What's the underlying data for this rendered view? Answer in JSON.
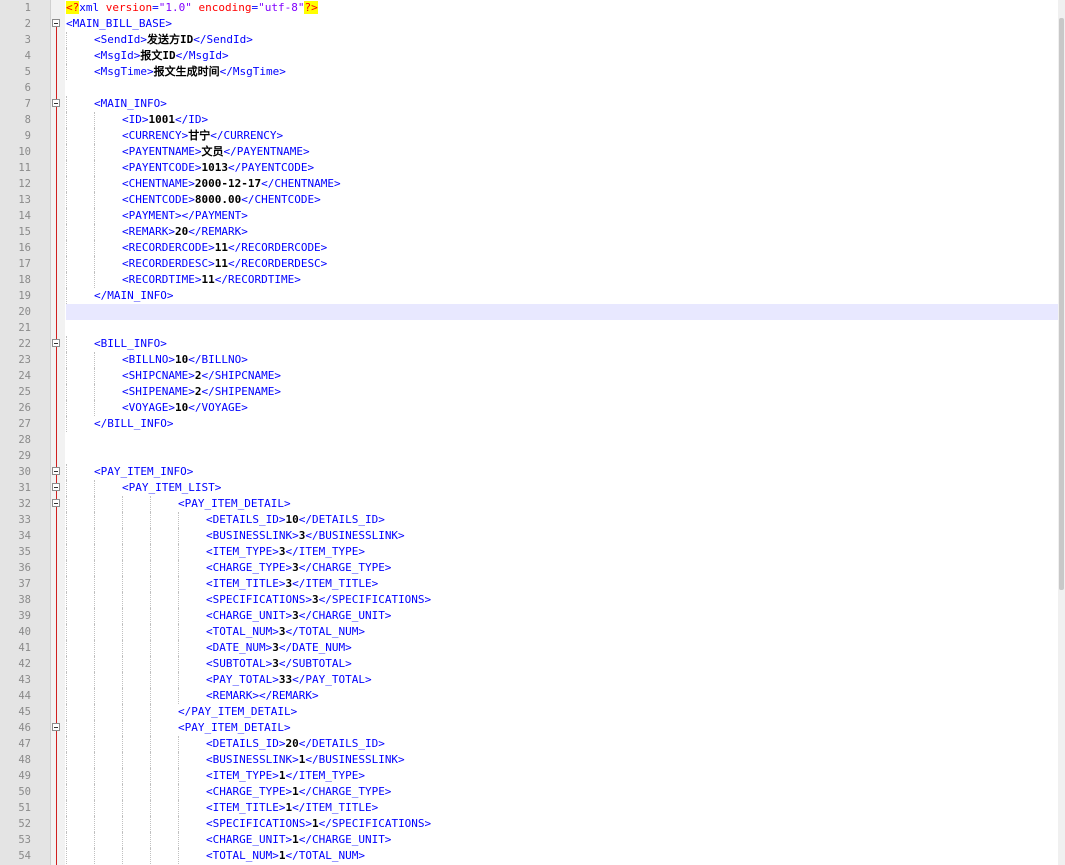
{
  "editor": {
    "lines": [
      {
        "n": "1",
        "depth": 0,
        "fold": false,
        "parts": [
          [
            "pi",
            "<?"
          ],
          [
            "tag",
            "xml "
          ],
          [
            "attr",
            "version"
          ],
          [
            "tag",
            "="
          ],
          [
            "val",
            "\"1.0\""
          ],
          [
            "tag",
            " "
          ],
          [
            "attr",
            "encoding"
          ],
          [
            "tag",
            "="
          ],
          [
            "val",
            "\"utf-8\""
          ],
          [
            "pi",
            "?>"
          ]
        ]
      },
      {
        "n": "2",
        "depth": 0,
        "fold": true,
        "parts": [
          [
            "tag",
            "<MAIN_BILL_BASE>"
          ]
        ]
      },
      {
        "n": "3",
        "depth": 1,
        "fold": false,
        "parts": [
          [
            "tag",
            "<SendId>"
          ],
          [
            "txt",
            "发送方ID"
          ],
          [
            "tag",
            "</SendId>"
          ]
        ]
      },
      {
        "n": "4",
        "depth": 1,
        "fold": false,
        "parts": [
          [
            "tag",
            "<MsgId>"
          ],
          [
            "txt",
            "报文ID"
          ],
          [
            "tag",
            "</MsgId>"
          ]
        ]
      },
      {
        "n": "5",
        "depth": 1,
        "fold": false,
        "parts": [
          [
            "tag",
            "<MsgTime>"
          ],
          [
            "txt",
            "报文生成时间"
          ],
          [
            "tag",
            "</MsgTime>"
          ]
        ]
      },
      {
        "n": "6",
        "depth": 0,
        "fold": false,
        "parts": []
      },
      {
        "n": "7",
        "depth": 1,
        "fold": true,
        "parts": [
          [
            "tag",
            "<MAIN_INFO>"
          ]
        ]
      },
      {
        "n": "8",
        "depth": 2,
        "fold": false,
        "parts": [
          [
            "tag",
            "<ID>"
          ],
          [
            "txt",
            "1001"
          ],
          [
            "tag",
            "</ID>"
          ]
        ]
      },
      {
        "n": "9",
        "depth": 2,
        "fold": false,
        "parts": [
          [
            "tag",
            "<CURRENCY>"
          ],
          [
            "txt",
            "甘宁"
          ],
          [
            "tag",
            "</CURRENCY>"
          ]
        ]
      },
      {
        "n": "10",
        "depth": 2,
        "fold": false,
        "parts": [
          [
            "tag",
            "<PAYENTNAME>"
          ],
          [
            "txt",
            "文员"
          ],
          [
            "tag",
            "</PAYENTNAME>"
          ]
        ]
      },
      {
        "n": "11",
        "depth": 2,
        "fold": false,
        "parts": [
          [
            "tag",
            "<PAYENTCODE>"
          ],
          [
            "txt",
            "1013"
          ],
          [
            "tag",
            "</PAYENTCODE>"
          ]
        ]
      },
      {
        "n": "12",
        "depth": 2,
        "fold": false,
        "parts": [
          [
            "tag",
            "<CHENTNAME>"
          ],
          [
            "txt",
            "2000-12-17"
          ],
          [
            "tag",
            "</CHENTNAME>"
          ]
        ]
      },
      {
        "n": "13",
        "depth": 2,
        "fold": false,
        "parts": [
          [
            "tag",
            "<CHENTCODE>"
          ],
          [
            "txt",
            "8000.00"
          ],
          [
            "tag",
            "</CHENTCODE>"
          ]
        ]
      },
      {
        "n": "14",
        "depth": 2,
        "fold": false,
        "parts": [
          [
            "tag",
            "<PAYMENT></PAYMENT>"
          ]
        ]
      },
      {
        "n": "15",
        "depth": 2,
        "fold": false,
        "parts": [
          [
            "tag",
            "<REMARK>"
          ],
          [
            "txt",
            "20"
          ],
          [
            "tag",
            "</REMARK>"
          ]
        ]
      },
      {
        "n": "16",
        "depth": 2,
        "fold": false,
        "parts": [
          [
            "tag",
            "<RECORDERCODE>"
          ],
          [
            "txt",
            "11"
          ],
          [
            "tag",
            "</RECORDERCODE>"
          ]
        ]
      },
      {
        "n": "17",
        "depth": 2,
        "fold": false,
        "parts": [
          [
            "tag",
            "<RECORDERDESC>"
          ],
          [
            "txt",
            "11"
          ],
          [
            "tag",
            "</RECORDERDESC>"
          ]
        ]
      },
      {
        "n": "18",
        "depth": 2,
        "fold": false,
        "parts": [
          [
            "tag",
            "<RECORDTIME>"
          ],
          [
            "txt",
            "11"
          ],
          [
            "tag",
            "</RECORDTIME>"
          ]
        ]
      },
      {
        "n": "19",
        "depth": 1,
        "fold": false,
        "parts": [
          [
            "tag",
            "</MAIN_INFO>"
          ]
        ]
      },
      {
        "n": "20",
        "depth": 0,
        "fold": false,
        "current": true,
        "parts": []
      },
      {
        "n": "21",
        "depth": 0,
        "fold": false,
        "parts": []
      },
      {
        "n": "22",
        "depth": 1,
        "fold": true,
        "parts": [
          [
            "tag",
            "<BILL_INFO>"
          ]
        ]
      },
      {
        "n": "23",
        "depth": 2,
        "fold": false,
        "parts": [
          [
            "tag",
            "<BILLNO>"
          ],
          [
            "txt",
            "10"
          ],
          [
            "tag",
            "</BILLNO>"
          ]
        ]
      },
      {
        "n": "24",
        "depth": 2,
        "fold": false,
        "parts": [
          [
            "tag",
            "<SHIPCNAME>"
          ],
          [
            "txt",
            "2"
          ],
          [
            "tag",
            "</SHIPCNAME>"
          ]
        ]
      },
      {
        "n": "25",
        "depth": 2,
        "fold": false,
        "parts": [
          [
            "tag",
            "<SHIPENAME>"
          ],
          [
            "txt",
            "2"
          ],
          [
            "tag",
            "</SHIPENAME>"
          ]
        ]
      },
      {
        "n": "26",
        "depth": 2,
        "fold": false,
        "parts": [
          [
            "tag",
            "<VOYAGE>"
          ],
          [
            "txt",
            "10"
          ],
          [
            "tag",
            "</VOYAGE>"
          ]
        ]
      },
      {
        "n": "27",
        "depth": 1,
        "fold": false,
        "parts": [
          [
            "tag",
            "</BILL_INFO>"
          ]
        ]
      },
      {
        "n": "28",
        "depth": 0,
        "fold": false,
        "parts": []
      },
      {
        "n": "29",
        "depth": 0,
        "fold": false,
        "parts": []
      },
      {
        "n": "30",
        "depth": 1,
        "fold": true,
        "parts": [
          [
            "tag",
            "<PAY_ITEM_INFO>"
          ]
        ]
      },
      {
        "n": "31",
        "depth": 2,
        "fold": true,
        "parts": [
          [
            "tag",
            "<PAY_ITEM_LIST>"
          ]
        ]
      },
      {
        "n": "32",
        "depth": 4,
        "fold": true,
        "parts": [
          [
            "tag",
            "<PAY_ITEM_DETAIL>"
          ]
        ]
      },
      {
        "n": "33",
        "depth": 5,
        "fold": false,
        "parts": [
          [
            "tag",
            "<DETAILS_ID>"
          ],
          [
            "txt",
            "10"
          ],
          [
            "tag",
            "</DETAILS_ID>"
          ]
        ]
      },
      {
        "n": "34",
        "depth": 5,
        "fold": false,
        "parts": [
          [
            "tag",
            "<BUSINESSLINK>"
          ],
          [
            "txt",
            "3"
          ],
          [
            "tag",
            "</BUSINESSLINK>"
          ]
        ]
      },
      {
        "n": "35",
        "depth": 5,
        "fold": false,
        "parts": [
          [
            "tag",
            "<ITEM_TYPE>"
          ],
          [
            "txt",
            "3"
          ],
          [
            "tag",
            "</ITEM_TYPE>"
          ]
        ]
      },
      {
        "n": "36",
        "depth": 5,
        "fold": false,
        "parts": [
          [
            "tag",
            "<CHARGE_TYPE>"
          ],
          [
            "txt",
            "3"
          ],
          [
            "tag",
            "</CHARGE_TYPE>"
          ]
        ]
      },
      {
        "n": "37",
        "depth": 5,
        "fold": false,
        "parts": [
          [
            "tag",
            "<ITEM_TITLE>"
          ],
          [
            "txt",
            "3"
          ],
          [
            "tag",
            "</ITEM_TITLE>"
          ]
        ]
      },
      {
        "n": "38",
        "depth": 5,
        "fold": false,
        "parts": [
          [
            "tag",
            "<SPECIFICATIONS>"
          ],
          [
            "txt",
            "3"
          ],
          [
            "tag",
            "</SPECIFICATIONS>"
          ]
        ]
      },
      {
        "n": "39",
        "depth": 5,
        "fold": false,
        "parts": [
          [
            "tag",
            "<CHARGE_UNIT>"
          ],
          [
            "txt",
            "3"
          ],
          [
            "tag",
            "</CHARGE_UNIT>"
          ]
        ]
      },
      {
        "n": "40",
        "depth": 5,
        "fold": false,
        "parts": [
          [
            "tag",
            "<TOTAL_NUM>"
          ],
          [
            "txt",
            "3"
          ],
          [
            "tag",
            "</TOTAL_NUM>"
          ]
        ]
      },
      {
        "n": "41",
        "depth": 5,
        "fold": false,
        "parts": [
          [
            "tag",
            "<DATE_NUM>"
          ],
          [
            "txt",
            "3"
          ],
          [
            "tag",
            "</DATE_NUM>"
          ]
        ]
      },
      {
        "n": "42",
        "depth": 5,
        "fold": false,
        "parts": [
          [
            "tag",
            "<SUBTOTAL>"
          ],
          [
            "txt",
            "3"
          ],
          [
            "tag",
            "</SUBTOTAL>"
          ]
        ]
      },
      {
        "n": "43",
        "depth": 5,
        "fold": false,
        "parts": [
          [
            "tag",
            "<PAY_TOTAL>"
          ],
          [
            "txt",
            "33"
          ],
          [
            "tag",
            "</PAY_TOTAL>"
          ]
        ]
      },
      {
        "n": "44",
        "depth": 5,
        "fold": false,
        "parts": [
          [
            "tag",
            "<REMARK></REMARK>"
          ]
        ]
      },
      {
        "n": "45",
        "depth": 4,
        "fold": false,
        "parts": [
          [
            "tag",
            "</PAY_ITEM_DETAIL>"
          ]
        ]
      },
      {
        "n": "46",
        "depth": 4,
        "fold": true,
        "parts": [
          [
            "tag",
            "<PAY_ITEM_DETAIL>"
          ]
        ]
      },
      {
        "n": "47",
        "depth": 5,
        "fold": false,
        "parts": [
          [
            "tag",
            "<DETAILS_ID>"
          ],
          [
            "txt",
            "20"
          ],
          [
            "tag",
            "</DETAILS_ID>"
          ]
        ]
      },
      {
        "n": "48",
        "depth": 5,
        "fold": false,
        "parts": [
          [
            "tag",
            "<BUSINESSLINK>"
          ],
          [
            "txt",
            "1"
          ],
          [
            "tag",
            "</BUSINESSLINK>"
          ]
        ]
      },
      {
        "n": "49",
        "depth": 5,
        "fold": false,
        "parts": [
          [
            "tag",
            "<ITEM_TYPE>"
          ],
          [
            "txt",
            "1"
          ],
          [
            "tag",
            "</ITEM_TYPE>"
          ]
        ]
      },
      {
        "n": "50",
        "depth": 5,
        "fold": false,
        "parts": [
          [
            "tag",
            "<CHARGE_TYPE>"
          ],
          [
            "txt",
            "1"
          ],
          [
            "tag",
            "</CHARGE_TYPE>"
          ]
        ]
      },
      {
        "n": "51",
        "depth": 5,
        "fold": false,
        "parts": [
          [
            "tag",
            "<ITEM_TITLE>"
          ],
          [
            "txt",
            "1"
          ],
          [
            "tag",
            "</ITEM_TITLE>"
          ]
        ]
      },
      {
        "n": "52",
        "depth": 5,
        "fold": false,
        "parts": [
          [
            "tag",
            "<SPECIFICATIONS>"
          ],
          [
            "txt",
            "1"
          ],
          [
            "tag",
            "</SPECIFICATIONS>"
          ]
        ]
      },
      {
        "n": "53",
        "depth": 5,
        "fold": false,
        "parts": [
          [
            "tag",
            "<CHARGE_UNIT>"
          ],
          [
            "txt",
            "1"
          ],
          [
            "tag",
            "</CHARGE_UNIT>"
          ]
        ]
      },
      {
        "n": "54",
        "depth": 5,
        "fold": false,
        "parts": [
          [
            "tag",
            "<TOTAL_NUM>"
          ],
          [
            "txt",
            "1"
          ],
          [
            "tag",
            "</TOTAL_NUM>"
          ]
        ]
      }
    ]
  }
}
